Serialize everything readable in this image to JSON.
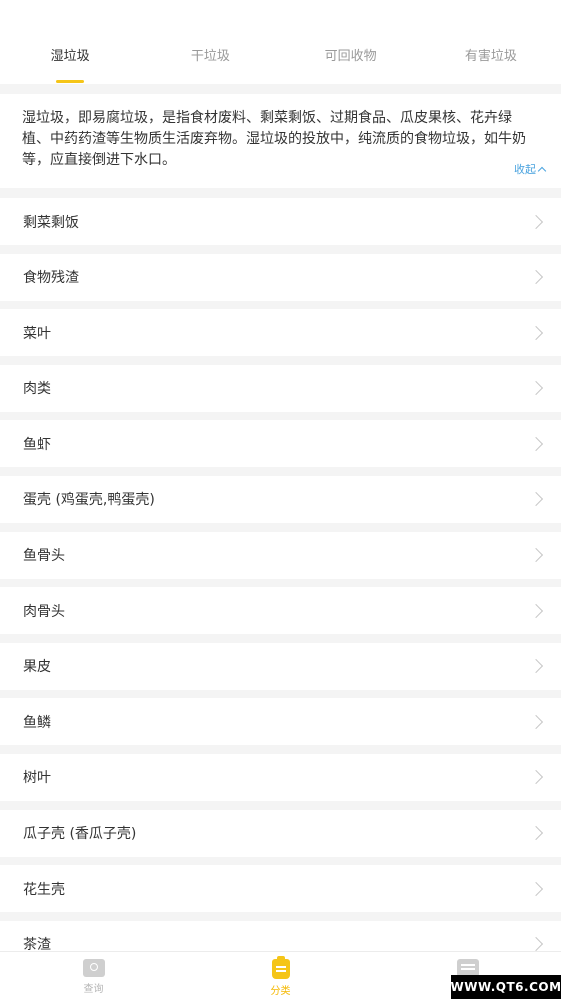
{
  "tabs": [
    {
      "label": "湿垃圾",
      "active": true
    },
    {
      "label": "干垃圾",
      "active": false
    },
    {
      "label": "可回收物",
      "active": false
    },
    {
      "label": "有害垃圾",
      "active": false
    }
  ],
  "description": {
    "text": "湿垃圾，即易腐垃圾，是指食材废料、剩菜剩饭、过期食品、瓜皮果核、花卉绿植、中药药渣等生物质生活废弃物。湿垃圾的投放中，纯流质的食物垃圾，如牛奶等，应直接倒进下水口。",
    "collapse_label": "收起"
  },
  "items": [
    {
      "label": "剩菜剩饭"
    },
    {
      "label": "食物残渣"
    },
    {
      "label": "菜叶"
    },
    {
      "label": "肉类"
    },
    {
      "label": "鱼虾"
    },
    {
      "label": "蛋壳 (鸡蛋壳,鸭蛋壳)"
    },
    {
      "label": "鱼骨头"
    },
    {
      "label": "肉骨头"
    },
    {
      "label": "果皮"
    },
    {
      "label": "鱼鳞"
    },
    {
      "label": "树叶"
    },
    {
      "label": "瓜子壳 (香瓜子壳)"
    },
    {
      "label": "花生壳"
    },
    {
      "label": "茶渣"
    }
  ],
  "bottom_nav": [
    {
      "label": "查询",
      "icon": "search-icon",
      "active": false
    },
    {
      "label": "分类",
      "icon": "category-icon",
      "active": true
    },
    {
      "label": "",
      "icon": "mine-icon",
      "active": false
    }
  ],
  "watermark": "WWW.QT6.COM",
  "colors": {
    "accent": "#f5c518",
    "link": "#4aa3df"
  }
}
